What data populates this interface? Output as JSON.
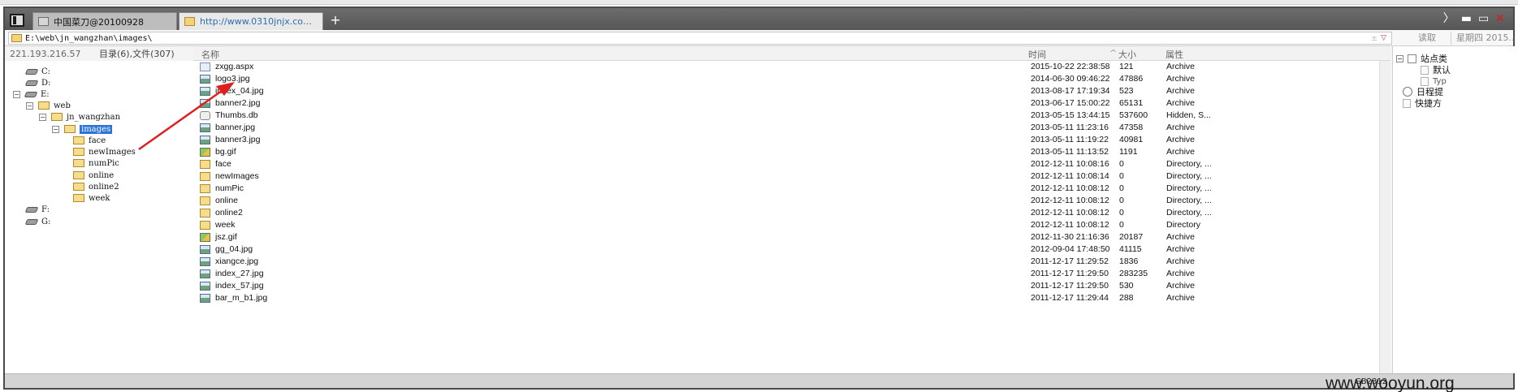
{
  "tabs": [
    {
      "label": "中国菜刀@20100928"
    },
    {
      "label": "http://www.0310jnjx.com/ima..."
    }
  ],
  "new_tab_symbol": "+",
  "window_controls": {
    "more": "〉",
    "minimize": "▬",
    "maximize": "▭",
    "close": "✕"
  },
  "address": {
    "path": "E:\\web\\jn_wangzhan\\images\\",
    "extras": "± ",
    "dropdown": "▽",
    "read_button": "读取",
    "date_label": "星期四 2015..."
  },
  "tree_panel": {
    "ip": "221.193.216.57",
    "counts": "目录(6),文件(307)",
    "nodes": [
      {
        "label": "C:",
        "kind": "drive"
      },
      {
        "label": "D:",
        "kind": "drive"
      },
      {
        "label": "E:",
        "kind": "drive",
        "expander": "−"
      },
      {
        "label": "web",
        "kind": "folder",
        "expander": "−"
      },
      {
        "label": "jn_wangzhan",
        "kind": "folder",
        "expander": "−"
      },
      {
        "label": "images",
        "kind": "folder",
        "expander": "−",
        "selected": true
      },
      {
        "label": "face",
        "kind": "folder"
      },
      {
        "label": "newImages",
        "kind": "folder"
      },
      {
        "label": "numPic",
        "kind": "folder"
      },
      {
        "label": "online",
        "kind": "folder"
      },
      {
        "label": "online2",
        "kind": "folder"
      },
      {
        "label": "week",
        "kind": "folder"
      },
      {
        "label": "F:",
        "kind": "drive"
      },
      {
        "label": "G:",
        "kind": "drive"
      }
    ]
  },
  "file_list": {
    "columns": {
      "name": "名称",
      "time": "时间",
      "sort_indicator": "^",
      "size": "大小",
      "attr": "属性"
    },
    "rows": [
      {
        "icon": "doc",
        "name": "zxgg.aspx",
        "time": "2015-10-22 22:38:58",
        "size": "121",
        "attr": "Archive"
      },
      {
        "icon": "image",
        "name": "logo3.jpg",
        "time": "2014-06-30 09:46:22",
        "size": "47886",
        "attr": "Archive"
      },
      {
        "icon": "image",
        "name": "index_04.jpg",
        "time": "2013-08-17 17:19:34",
        "size": "523",
        "attr": "Archive"
      },
      {
        "icon": "image",
        "name": "banner2.jpg",
        "time": "2013-06-17 15:00:22",
        "size": "65131",
        "attr": "Archive"
      },
      {
        "icon": "db",
        "name": "Thumbs.db",
        "time": "2013-05-15 13:44:15",
        "size": "537600",
        "attr": "Hidden, S..."
      },
      {
        "icon": "image",
        "name": "banner.jpg",
        "time": "2013-05-11 11:23:16",
        "size": "47358",
        "attr": "Archive"
      },
      {
        "icon": "image",
        "name": "banner3.jpg",
        "time": "2013-05-11 11:19:22",
        "size": "40981",
        "attr": "Archive"
      },
      {
        "icon": "gif",
        "name": "bg.gif",
        "time": "2013-05-11 11:13:52",
        "size": "1191",
        "attr": "Archive"
      },
      {
        "icon": "folder",
        "name": "face",
        "time": "2012-12-11 10:08:16",
        "size": "0",
        "attr": "Directory, ..."
      },
      {
        "icon": "folder",
        "name": "newImages",
        "time": "2012-12-11 10:08:14",
        "size": "0",
        "attr": "Directory, ..."
      },
      {
        "icon": "folder",
        "name": "numPic",
        "time": "2012-12-11 10:08:12",
        "size": "0",
        "attr": "Directory, ..."
      },
      {
        "icon": "folder",
        "name": "online",
        "time": "2012-12-11 10:08:12",
        "size": "0",
        "attr": "Directory, ..."
      },
      {
        "icon": "folder",
        "name": "online2",
        "time": "2012-12-11 10:08:12",
        "size": "0",
        "attr": "Directory, ..."
      },
      {
        "icon": "folder",
        "name": "week",
        "time": "2012-12-11 10:08:12",
        "size": "0",
        "attr": "Directory"
      },
      {
        "icon": "gif",
        "name": "jsz.gif",
        "time": "2012-11-30 21:16:36",
        "size": "20187",
        "attr": "Archive"
      },
      {
        "icon": "image",
        "name": "gg_04.jpg",
        "time": "2012-09-04 17:48:50",
        "size": "41115",
        "attr": "Archive"
      },
      {
        "icon": "image",
        "name": "xiangce.jpg",
        "time": "2011-12-17 11:29:52",
        "size": "1836",
        "attr": "Archive"
      },
      {
        "icon": "image",
        "name": "index_27.jpg",
        "time": "2011-12-17 11:29:50",
        "size": "283235",
        "attr": "Archive"
      },
      {
        "icon": "image",
        "name": "index_57.jpg",
        "time": "2011-12-17 11:29:50",
        "size": "530",
        "attr": "Archive"
      },
      {
        "icon": "image",
        "name": "bar_m_b1.jpg",
        "time": "2011-12-17 11:29:44",
        "size": "288",
        "attr": "Archive"
      }
    ]
  },
  "right_panel": {
    "items": [
      {
        "label": "站点类",
        "kind": "root",
        "expander": "−"
      },
      {
        "label": "默认",
        "kind": "child"
      },
      {
        "label": "Typ",
        "kind": "child"
      },
      {
        "label": "日程提",
        "kind": "schedule"
      },
      {
        "label": "快捷方",
        "kind": "shortcut"
      }
    ]
  },
  "status_bar": {
    "encoding": "GB2312"
  },
  "watermark": "www.wooyun.org",
  "colors": {
    "selection": "#2b73d6",
    "annotation_arrow": "#e02020",
    "tab_url": "#2a6fb0",
    "folder": "#f6dd8c"
  }
}
